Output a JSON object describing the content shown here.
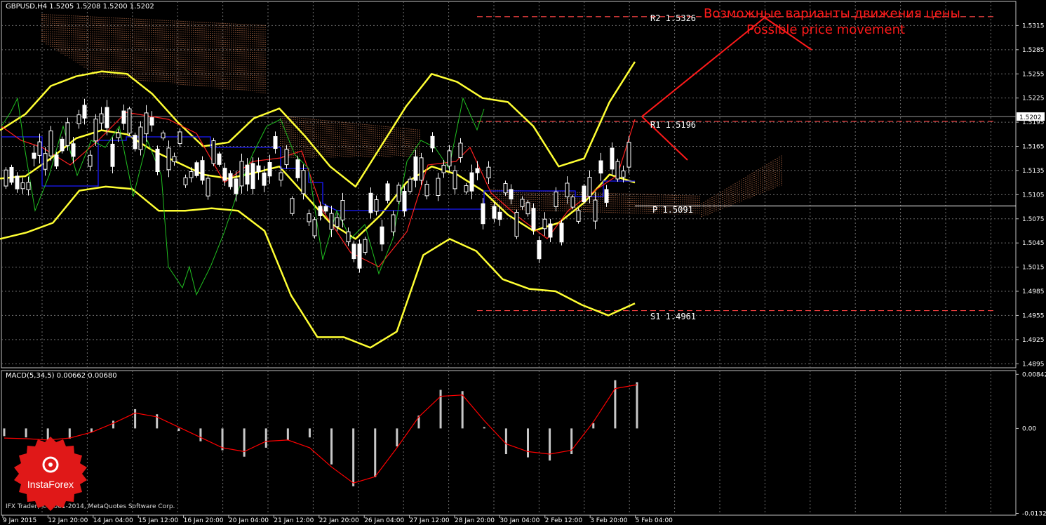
{
  "header": {
    "symbol_ohlc": "GBPUSD,H4  1.5205 1.5208 1.5200 1.5202",
    "macd_label": "MACD(5,34,5) 0.00662 0.00680"
  },
  "annotation": {
    "ru": "Возможные варианты движения цены",
    "en": "Possible price movement"
  },
  "levels": {
    "r2": "R2 1.5326",
    "r1": "R1 1.5196",
    "p": "P 1.5091",
    "s1": "S1 1.4961"
  },
  "copyright": "IFX Trader, © 2001-2014, MetaQuotes Software Corp.",
  "logo_text": "InstaForex",
  "colors": {
    "background": "#000000",
    "grid": "#6e6e6e",
    "bull_candle": "#ffffff",
    "bear_candle": "#ffffff",
    "bollinger": "#ffff33",
    "kijun": "#1a1aff",
    "tenkan": "#ff2020",
    "chikou": "#20c020",
    "cloud": "#ff9966",
    "annotation": "#ff1a1a",
    "level_line": "#ff4444",
    "macd_hist": "#c8c8c8",
    "macd_signal": "#ff0000"
  },
  "chart_data": [
    {
      "type": "candlestick",
      "symbol": "GBPUSD",
      "timeframe": "H4",
      "current_price": 1.5202,
      "ylim": [
        1.489,
        1.5345
      ],
      "y_ticks": [
        1.5315,
        1.5285,
        1.5255,
        1.5225,
        1.5195,
        1.5165,
        1.5135,
        1.5105,
        1.5075,
        1.5045,
        1.5015,
        1.4985,
        1.4955,
        1.4925,
        1.4895
      ],
      "y_tick_labels": [
        "1.5315",
        "1.5285",
        "1.5255",
        "1.5225",
        "1.5195",
        "1.5165",
        "1.5135",
        "1.5105",
        "1.5075",
        "1.5045",
        "1.5015",
        "1.4985",
        "1.4955",
        "1.4925",
        "1.4895"
      ],
      "current_price_label": "1.5202",
      "x_tick_labels": [
        "9 Jan 2015",
        "12 Jan 20:00",
        "14 Jan 04:00",
        "15 Jan 12:00",
        "16 Jan 20:00",
        "20 Jan 04:00",
        "21 Jan 12:00",
        "22 Jan 20:00",
        "26 Jan 04:00",
        "27 Jan 12:00",
        "28 Jan 20:00",
        "30 Jan 04:00",
        "2 Feb 12:00",
        "3 Feb 20:00",
        "5 Feb 04:00"
      ],
      "levels": [
        {
          "name": "R2",
          "value": 1.5326
        },
        {
          "name": "R1",
          "value": 1.5196
        },
        {
          "name": "P",
          "value": 1.5091
        },
        {
          "name": "S1",
          "value": 1.4961
        }
      ],
      "bollinger_upper": [
        1.5185,
        1.5205,
        1.524,
        1.5252,
        1.5258,
        1.5255,
        1.523,
        1.5195,
        1.5165,
        1.517,
        1.52,
        1.5212,
        1.5178,
        1.514,
        1.5115,
        1.5165,
        1.5215,
        1.5255,
        1.5245,
        1.5225,
        1.522,
        1.519,
        1.514,
        1.515,
        1.522,
        1.527
      ],
      "bollinger_middle": [
        1.5125,
        1.5128,
        1.515,
        1.5175,
        1.5185,
        1.518,
        1.516,
        1.5145,
        1.513,
        1.5125,
        1.5132,
        1.514,
        1.5105,
        1.507,
        1.505,
        1.508,
        1.512,
        1.514,
        1.513,
        1.511,
        1.508,
        1.506,
        1.507,
        1.5095,
        1.513,
        1.512
      ],
      "bollinger_lower": [
        1.505,
        1.5058,
        1.507,
        1.511,
        1.5115,
        1.5112,
        1.5085,
        1.5085,
        1.5088,
        1.5085,
        1.506,
        1.498,
        1.4928,
        1.4928,
        1.4915,
        1.4935,
        1.503,
        1.505,
        1.5035,
        1.5,
        1.4988,
        1.4985,
        1.4968,
        1.4955,
        1.497
      ],
      "macd": {
        "ylim": [
          -0.0135,
          0.009
        ],
        "y_ticks": [
          0.00842,
          0.0,
          -0.01323
        ],
        "y_tick_labels": [
          "0.00842",
          "0.00",
          "-0.01323"
        ],
        "histogram": [
          -0.0012,
          -0.0014,
          -0.0018,
          -0.0016,
          -0.0006,
          0.0012,
          0.003,
          0.0022,
          -0.0004,
          -0.002,
          -0.0034,
          -0.0044,
          -0.003,
          -0.0018,
          -0.0014,
          -0.0056,
          -0.009,
          -0.0076,
          -0.0028,
          0.002,
          0.006,
          0.0058,
          0.0002,
          -0.004,
          -0.0045,
          -0.005,
          -0.004,
          0.0008,
          0.0075,
          0.0072
        ],
        "signal": [
          -0.0015,
          -0.0016,
          -0.0018,
          -0.0015,
          -0.0006,
          0.0008,
          0.0024,
          0.0018,
          0.0002,
          -0.0014,
          -0.003,
          -0.0036,
          -0.002,
          -0.0018,
          -0.003,
          -0.006,
          -0.0085,
          -0.0075,
          -0.003,
          0.0018,
          0.005,
          0.0052,
          0.0012,
          -0.0024,
          -0.0036,
          -0.004,
          -0.0034,
          0.001,
          0.0062,
          0.0068
        ]
      }
    }
  ]
}
